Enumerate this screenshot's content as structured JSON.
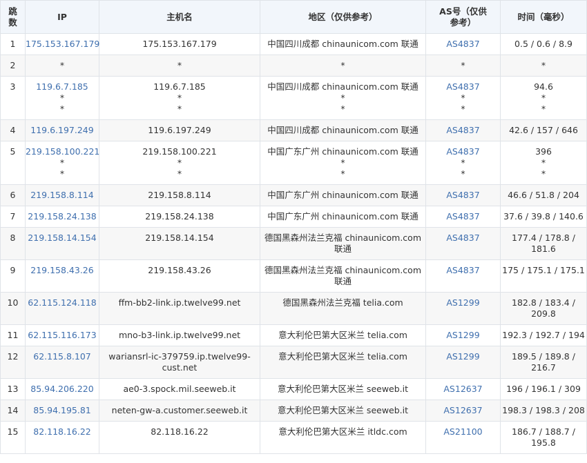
{
  "headers": {
    "hop": "跳\n数",
    "ip": "IP",
    "host": "主机名",
    "region": "地区（仅供参考）",
    "as": "AS号（仅供参考）",
    "time": "时间（毫秒）"
  },
  "rows": [
    {
      "hop": "1",
      "ip": [
        "175.153.167.179"
      ],
      "host": [
        "175.153.167.179"
      ],
      "region": [
        "中国四川成都 chinaunicom.com 联通"
      ],
      "as": [
        "AS4837"
      ],
      "time": [
        "0.5 / 0.6 / 8.9"
      ]
    },
    {
      "hop": "2",
      "ip": [
        "*"
      ],
      "host": [
        "*"
      ],
      "region": [
        "*"
      ],
      "as": [
        "*"
      ],
      "time": [
        "*"
      ]
    },
    {
      "hop": "3",
      "ip": [
        "119.6.7.185",
        "*",
        "*"
      ],
      "host": [
        "119.6.7.185",
        "*",
        "*"
      ],
      "region": [
        "中国四川成都 chinaunicom.com 联通",
        "*",
        "*"
      ],
      "as": [
        "AS4837",
        "*",
        "*"
      ],
      "time": [
        "94.6",
        "*",
        "*"
      ]
    },
    {
      "hop": "4",
      "ip": [
        "119.6.197.249"
      ],
      "host": [
        "119.6.197.249"
      ],
      "region": [
        "中国四川成都 chinaunicom.com 联通"
      ],
      "as": [
        "AS4837"
      ],
      "time": [
        "42.6 / 157 / 646"
      ]
    },
    {
      "hop": "5",
      "ip": [
        "219.158.100.221",
        "*",
        "*"
      ],
      "host": [
        "219.158.100.221",
        "*",
        "*"
      ],
      "region": [
        "中国广东广州 chinaunicom.com 联通",
        "*",
        "*"
      ],
      "as": [
        "AS4837",
        "*",
        "*"
      ],
      "time": [
        "396",
        "*",
        "*"
      ]
    },
    {
      "hop": "6",
      "ip": [
        "219.158.8.114"
      ],
      "host": [
        "219.158.8.114"
      ],
      "region": [
        "中国广东广州 chinaunicom.com 联通"
      ],
      "as": [
        "AS4837"
      ],
      "time": [
        "46.6 / 51.8 / 204"
      ]
    },
    {
      "hop": "7",
      "ip": [
        "219.158.24.138"
      ],
      "host": [
        "219.158.24.138"
      ],
      "region": [
        "中国广东广州 chinaunicom.com 联通"
      ],
      "as": [
        "AS4837"
      ],
      "time": [
        "37.6 / 39.8 / 140.6"
      ]
    },
    {
      "hop": "8",
      "ip": [
        "219.158.14.154"
      ],
      "host": [
        "219.158.14.154"
      ],
      "region": [
        "德国黑森州法兰克福 chinaunicom.com",
        "联通"
      ],
      "as": [
        "AS4837"
      ],
      "time": [
        "177.4 / 178.8 /",
        "181.6"
      ]
    },
    {
      "hop": "9",
      "ip": [
        "219.158.43.26"
      ],
      "host": [
        "219.158.43.26"
      ],
      "region": [
        "德国黑森州法兰克福 chinaunicom.com",
        "联通"
      ],
      "as": [
        "AS4837"
      ],
      "time": [
        "175 / 175.1 / 175.1"
      ]
    },
    {
      "hop": "10",
      "ip": [
        "62.115.124.118"
      ],
      "host": [
        "ffm-bb2-link.ip.twelve99.net"
      ],
      "region": [
        "德国黑森州法兰克福 telia.com"
      ],
      "as": [
        "AS1299"
      ],
      "time": [
        "182.8 / 183.4 /",
        "209.8"
      ]
    },
    {
      "hop": "11",
      "ip": [
        "62.115.116.173"
      ],
      "host": [
        "mno-b3-link.ip.twelve99.net"
      ],
      "region": [
        "意大利伦巴第大区米兰 telia.com"
      ],
      "as": [
        "AS1299"
      ],
      "time": [
        "192.3 / 192.7 / 194"
      ]
    },
    {
      "hop": "12",
      "ip": [
        "62.115.8.107"
      ],
      "host": [
        "wariansrl-ic-379759.ip.twelve99-",
        "cust.net"
      ],
      "region": [
        "意大利伦巴第大区米兰 telia.com"
      ],
      "as": [
        "AS1299"
      ],
      "time": [
        "189.5 / 189.8 /",
        "216.7"
      ]
    },
    {
      "hop": "13",
      "ip": [
        "85.94.206.220"
      ],
      "host": [
        "ae0-3.spock.mil.seeweb.it"
      ],
      "region": [
        "意大利伦巴第大区米兰 seeweb.it"
      ],
      "as": [
        "AS12637"
      ],
      "time": [
        "196 / 196.1 / 309"
      ]
    },
    {
      "hop": "14",
      "ip": [
        "85.94.195.81"
      ],
      "host": [
        "neten-gw-a.customer.seeweb.it"
      ],
      "region": [
        "意大利伦巴第大区米兰 seeweb.it"
      ],
      "as": [
        "AS12637"
      ],
      "time": [
        "198.3 / 198.3 / 208"
      ]
    },
    {
      "hop": "15",
      "ip": [
        "82.118.16.22"
      ],
      "host": [
        "82.118.16.22"
      ],
      "region": [
        "意大利伦巴第大区米兰 itldc.com"
      ],
      "as": [
        "AS21100"
      ],
      "time": [
        "186.7 / 188.7 /",
        "195.8"
      ]
    }
  ]
}
